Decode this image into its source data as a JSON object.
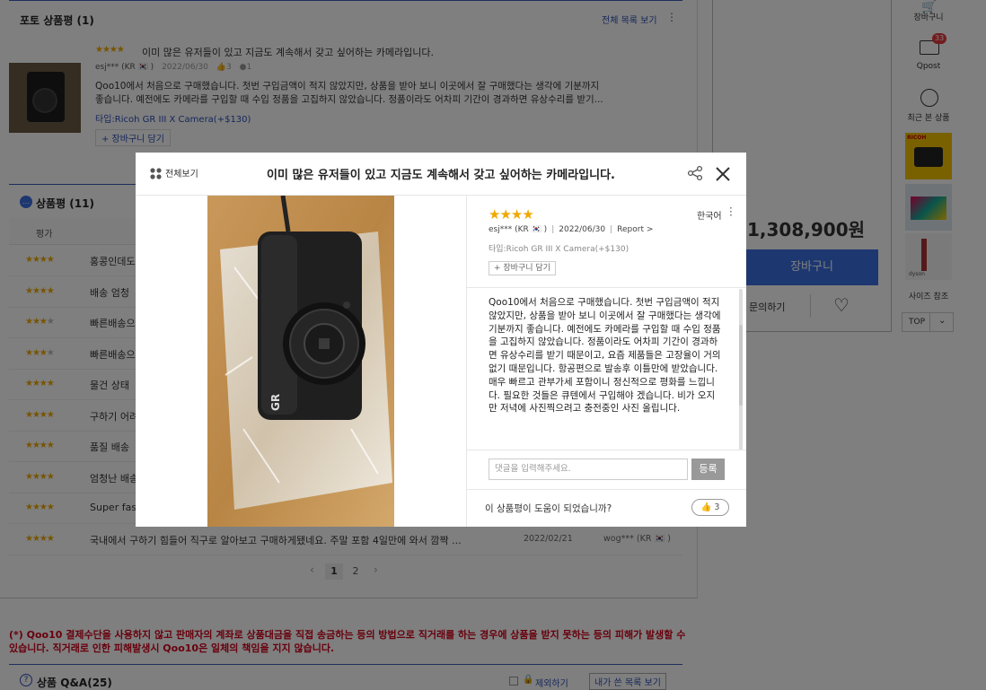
{
  "background": {
    "photo_review": {
      "title": "포토 상품평 (1)",
      "view_all": "전체 목록 보기",
      "item": {
        "stars": "★★★★",
        "title": "이미 많은 유저들이 있고 지금도 계속해서 갖고 싶어하는 카메라입니다.",
        "author": "esj*** (KR 🇰🇷 )",
        "date": "2022/06/30",
        "likes": "3",
        "comments": "1",
        "text1": "Qoo10에서 처음으로 구매했습니다. 첫번 구입금액이 적지 않았지만, 상품을 받아 보니 이곳에서 잘 구매했다는 생각에 기분까지",
        "text2": "좋습니다. 예전에도 카메라를 구입할 때 수입 정품을 고집하지 않았습니다. 정품이라도 어차피 기간이 경과하면 유상수리를 받기...",
        "type": "타입:Ricoh GR III X Camera(+$130)",
        "add_cart": "+ 장바구니 담기"
      }
    },
    "reviews": {
      "title": "상품평 (11)",
      "col_rating": "평가",
      "rows": [
        {
          "stars": "★★★★",
          "off": "",
          "text": "홍콩인데도"
        },
        {
          "stars": "★★★★",
          "off": "",
          "text": "배송 엄청"
        },
        {
          "stars": "★★★",
          "off": "★",
          "text": "빠른배송으"
        },
        {
          "stars": "★★★",
          "off": "★",
          "text": "빠른배송으"
        },
        {
          "stars": "★★★★",
          "off": "",
          "text": "물건 상태"
        },
        {
          "stars": "★★★★",
          "off": "",
          "text": "구하기 어려"
        },
        {
          "stars": "★★★★",
          "off": "",
          "text": "품질 배송"
        },
        {
          "stars": "★★★★",
          "off": "",
          "text": "엄청난 배송"
        },
        {
          "stars": "★★★★",
          "off": "",
          "text": "Super fast"
        }
      ],
      "last_row": {
        "stars": "★★★★",
        "text": "국내에서 구하기 힘들어 직구로 알아보고 구매하게됐네요. 주말 포함 4일만에 와서 깜짝 ...",
        "date": "2022/02/21",
        "author": "wog*** (KR 🇰🇷 )"
      },
      "pages": [
        "1",
        "2"
      ]
    },
    "notice": "(*) Qoo10 결제수단을 사용하지 않고 판매자의 계좌로 상품대금을 직접 송금하는 등의 방법으로 직거래를 하는 경우에 상품을 받지 못하는 등의 피해가 발생할 수 있습니다. 직거래로 인한 피해발생시 Qoo10은 일체의 책임을 지지 않습니다.",
    "qa": {
      "title": "상품 Q&A(25)",
      "exclude": "제외하기",
      "my_list": "내가 쓴 목록 보기"
    },
    "right_panel": {
      "price": "1,308,900원",
      "cart": "장바구니",
      "inquiry": "문의하기"
    },
    "rail": {
      "cart": "장바구니",
      "qpost": "Qpost",
      "qpost_badge": "33",
      "recent": "최근 본 상품",
      "thumb1_label": "RICOH",
      "thumb4_label": "dyson",
      "size_ref": "사이즈 참조",
      "top": "TOP"
    }
  },
  "modal": {
    "view_all": "전체보기",
    "title": "이미 많은 유저들이 있고 지금도 계속해서 갖고 싶어하는 카메라입니다.",
    "stars": "★★★★",
    "language": "한국어",
    "author": "esj*** (KR 🇰🇷 )",
    "date": "2022/06/30",
    "report": "Report >",
    "type": "타입:Ricoh GR III X Camera(+$130)",
    "add_cart": "+ 장바구니 담기",
    "body": "Qoo10에서 처음으로 구매했습니다. 첫번 구입금액이 적지 않았지만, 상품을 받아 보니 이곳에서 잘 구매했다는 생각에 기분까지 좋습니다. 예전에도 카메라를 구입할 때 수입 정품을 고집하지 않았습니다. 정품이라도 어차피 기간이 경과하면 유상수리를 받기 때문이고, 요즘 제품들은 고장율이 거의 없기 때문입니다. 항공편으로 발송후 이틀만에 받았습니다. 매우 빠르고 관부가세 포함이니 정신적으로 평화를 느낍니다. 필요한 것들은 큐텐에서 구입해야 겠습니다. 비가 오지만 저녁에 사진찍으려고 충전중인 사진 올립니다.",
    "comment_placeholder": "댓글을 입력해주세요.",
    "comment_submit": "등록",
    "helpful_question": "이 상품평이 도움이 되었습니까?",
    "like_count": "3",
    "camera_brand": "GR"
  }
}
